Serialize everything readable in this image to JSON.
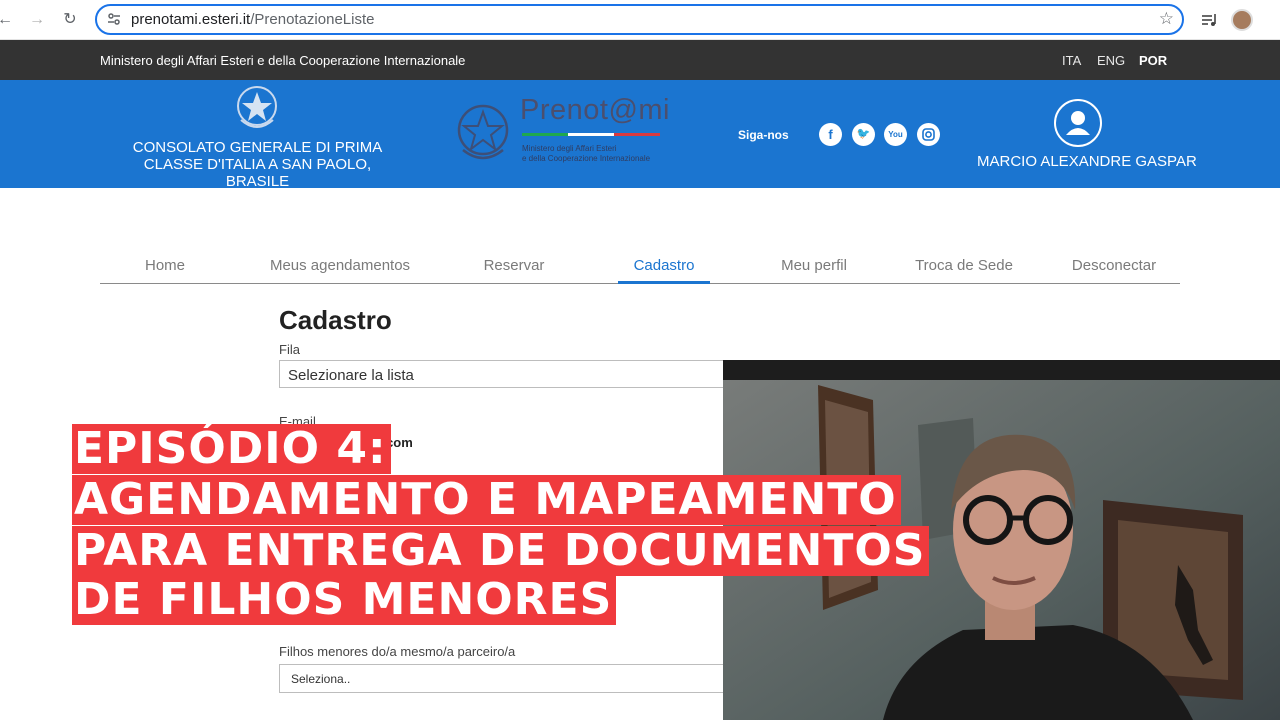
{
  "browser": {
    "url_host": "prenotami.esteri.it",
    "url_path": "/PrenotazioneListe"
  },
  "ministry_bar": {
    "name": "Ministero degli Affari Esteri e della Cooperazione Internazionale",
    "languages": [
      "ITA",
      "ENG",
      "POR"
    ],
    "active_language": "POR"
  },
  "header": {
    "consulate_line1": "CONSOLATO GENERALE DI PRIMA",
    "consulate_line2": "CLASSE D'ITALIA A SAN PAOLO,",
    "consulate_line3": "BRASILE",
    "logo_text": "Prenot@mi",
    "logo_sub1": "Ministero degli Affari Esteri",
    "logo_sub2": "e della Cooperazione Internazionale",
    "follow_label": "Siga-nos",
    "social_icons": [
      "facebook-icon",
      "twitter-icon",
      "youtube-icon",
      "instagram-icon"
    ],
    "user_name": "MARCIO ALEXANDRE GASPAR"
  },
  "tabs": [
    "Home",
    "Meus agendamentos",
    "Reservar",
    "Cadastro",
    "Meu perfil",
    "Troca de Sede",
    "Desconectar"
  ],
  "active_tab": "Cadastro",
  "form": {
    "title": "Cadastro",
    "fila_label": "Fila",
    "fila_value": "Selezionare la lista",
    "email_label": "E-mail",
    "email_value_visible": "ail.com",
    "children_label": "Filhos menores do/a mesmo/a parceiro/a",
    "children_value": "Seleziona.."
  },
  "overlay": {
    "line1": "EPISÓDIO 4:",
    "line2": "AGENDAMENTO E MAPEAMENTO",
    "line3": "PARA ENTREGA DE DOCUMENTOS",
    "line4": "DE FILHOS MENORES"
  },
  "colors": {
    "header_blue": "#1b75d0",
    "ministry_bar": "#333333",
    "overlay_red": "#f03a3d",
    "flag_green": "#1fa84f",
    "flag_red": "#d83a3f"
  }
}
